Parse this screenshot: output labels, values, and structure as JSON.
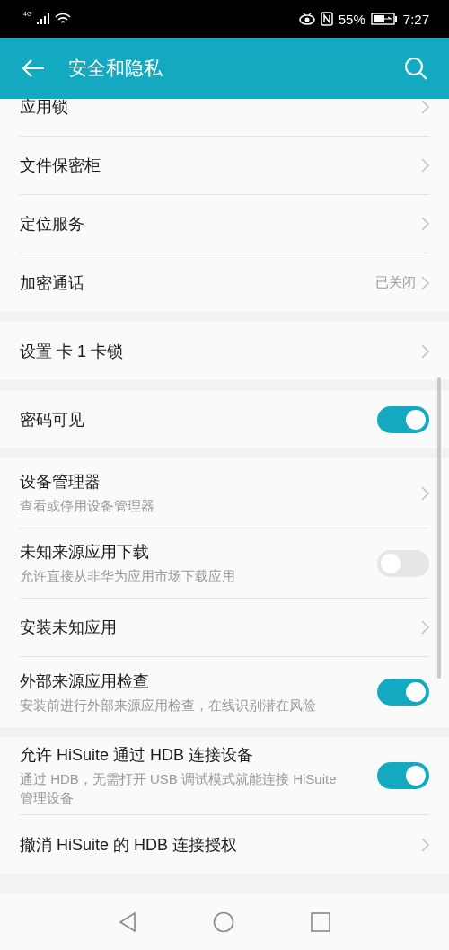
{
  "status_bar": {
    "network": "4G",
    "battery": "55%",
    "time": "7:27"
  },
  "app_bar": {
    "title": "安全和隐私"
  },
  "groups": [
    {
      "rows": [
        {
          "title": "应用锁",
          "kind": "link"
        },
        {
          "title": "文件保密柜",
          "kind": "link"
        },
        {
          "title": "定位服务",
          "kind": "link"
        },
        {
          "title": "加密通话",
          "kind": "link",
          "value": "已关闭"
        }
      ]
    },
    {
      "rows": [
        {
          "title": "设置 卡 1 卡锁",
          "kind": "link"
        }
      ]
    },
    {
      "rows": [
        {
          "title": "密码可见",
          "kind": "toggle",
          "on": true
        }
      ]
    },
    {
      "rows": [
        {
          "title": "设备管理器",
          "subtitle": "查看或停用设备管理器",
          "kind": "link"
        },
        {
          "title": "未知来源应用下载",
          "subtitle": "允许直接从非华为应用市场下载应用",
          "kind": "toggle",
          "on": false
        },
        {
          "title": "安装未知应用",
          "kind": "link"
        },
        {
          "title": "外部来源应用检查",
          "subtitle": "安装前进行外部来源应用检查，在线识别潜在风险",
          "kind": "toggle",
          "on": true
        }
      ]
    },
    {
      "rows": [
        {
          "title": "允许 HiSuite 通过 HDB 连接设备",
          "subtitle": "通过 HDB，无需打开 USB 调试模式就能连接 HiSuite 管理设备",
          "kind": "toggle",
          "on": true
        },
        {
          "title": "撤消 HiSuite 的 HDB 连接授权",
          "kind": "link"
        }
      ]
    }
  ]
}
